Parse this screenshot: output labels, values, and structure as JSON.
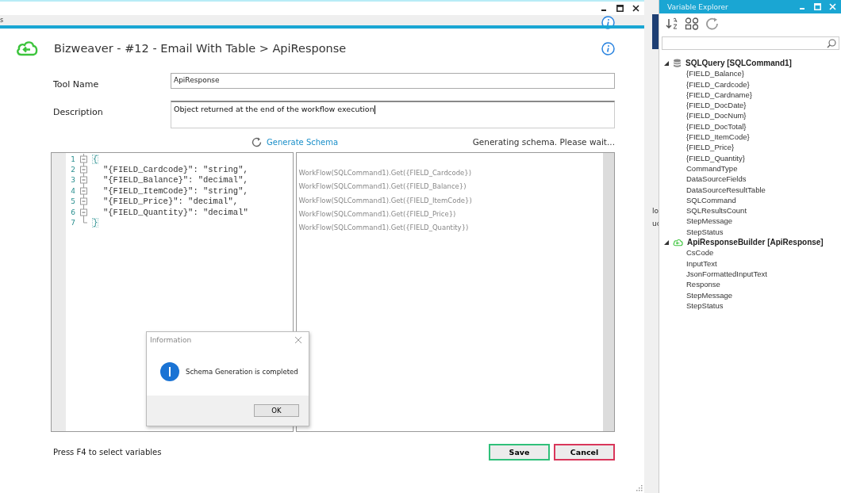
{
  "tab_strip_fragment": "s",
  "behind_window_fragments": [
    "lo",
    "uc"
  ],
  "header": {
    "title": "Bizweaver - #12 - Email With Table > ApiResponse"
  },
  "form": {
    "tool_name": {
      "label": "Tool Name",
      "value": "ApiResponse"
    },
    "description": {
      "label": "Description",
      "value": "Object returned at the end of the workflow execution"
    }
  },
  "generate_schema": {
    "label": "Generate Schema",
    "status": "Generating schema. Please wait..."
  },
  "json_editor": {
    "lines": [
      {
        "number": "1",
        "kind": "brace",
        "code": "{"
      },
      {
        "number": "2",
        "kind": "code",
        "code": "\"{FIELD_Cardcode}\": \"string\","
      },
      {
        "number": "3",
        "kind": "code",
        "code": "\"{FIELD_Balance}\": \"decimal\","
      },
      {
        "number": "4",
        "kind": "code",
        "code": "\"{FIELD_ItemCode}\": \"string\","
      },
      {
        "number": "5",
        "kind": "code",
        "code": "\"{FIELD_Price}\": \"decimal\","
      },
      {
        "number": "6",
        "kind": "code",
        "code": "\"{FIELD_Quantity}\": \"decimal\""
      },
      {
        "number": "7",
        "kind": "brace",
        "code": "}"
      }
    ]
  },
  "expressions": [
    "WorkFlow(SQLCommand1).Get({FIELD_Cardcode})",
    "WorkFlow(SQLCommand1).Get({FIELD_Balance})",
    "WorkFlow(SQLCommand1).Get({FIELD_ItemCode})",
    "WorkFlow(SQLCommand1).Get({FIELD_Price})",
    "WorkFlow(SQLCommand1).Get({FIELD_Quantity})"
  ],
  "dialog": {
    "title": "Information",
    "message": "Schema Generation is completed",
    "button": "OK"
  },
  "footer": {
    "hint": "Press F4 to select variables",
    "buttons": [
      {
        "label": "Save",
        "kind": "save"
      },
      {
        "label": "Cancel",
        "kind": "cancel"
      }
    ]
  },
  "variable_explorer": {
    "title": "Variable Explorer",
    "groups": [
      {
        "label": "SQLQuery [SQLCommand1]",
        "kind": "database",
        "expanded": true,
        "children": [
          {
            "label": "{FIELD_Balance}"
          },
          {
            "label": "{FIELD_Cardcode}"
          },
          {
            "label": "{FIELD_Cardname}"
          },
          {
            "label": "{FIELD_DocDate}"
          },
          {
            "label": "{FIELD_DocNum}"
          },
          {
            "label": "{FIELD_DocTotal}"
          },
          {
            "label": "{FIELD_ItemCode}"
          },
          {
            "label": "{FIELD_Price}"
          },
          {
            "label": "{FIELD_Quantity}"
          },
          {
            "label": "CommandType"
          },
          {
            "label": "DataSourceFields"
          },
          {
            "label": "DataSourceResultTable"
          },
          {
            "label": "SQLCommand"
          },
          {
            "label": "SQLResultsCount"
          },
          {
            "label": "StepMessage"
          },
          {
            "label": "StepStatus"
          }
        ]
      },
      {
        "label": "ApiResponseBuilder [ApiResponse]",
        "kind": "cloud",
        "expanded": true,
        "children": [
          {
            "label": "CsCode"
          },
          {
            "label": "InputText"
          },
          {
            "label": "JsonFormattedInputText"
          },
          {
            "label": "Response"
          },
          {
            "label": "StepMessage"
          },
          {
            "label": "StepStatus"
          }
        ]
      }
    ]
  }
}
